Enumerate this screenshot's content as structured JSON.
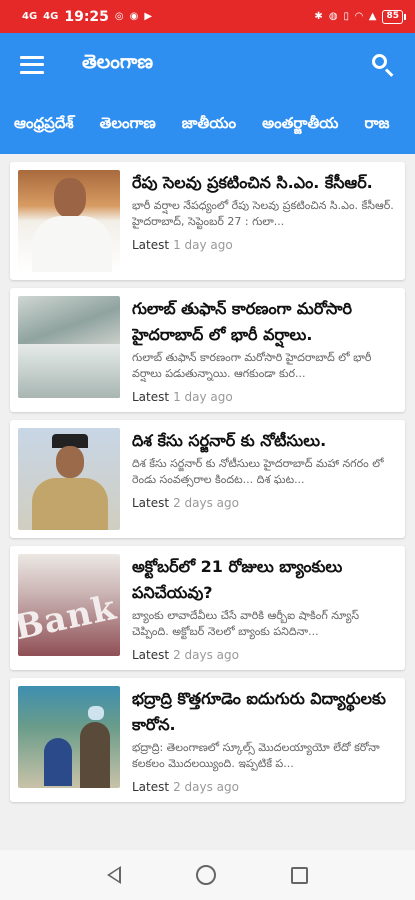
{
  "status_bar": {
    "signal_left": "4G",
    "signal_right": "4G",
    "time": "19:25",
    "battery": "85"
  },
  "app_bar": {
    "title": "తెలంగాణ",
    "menu_icon": "menu-icon",
    "search_icon": "search-icon"
  },
  "tabs": [
    "ఆంధ్రప్రదేశ్",
    "తెలంగాణ",
    "జాతీయం",
    "అంతర్జాతీయ",
    "రాజ"
  ],
  "articles": [
    {
      "title": "రేపు సెలవు ప్రకటించిన సి.ఎం. కేసీఆర్.",
      "snippet": "భారీ వర్షాల నేపధ్యంలో రేపు సెలవు ప్రకటించిన సి.ఎం. కేసీఆర్. హైదరాబాద్, సెప్టెంబర్ 27 : గులా...",
      "tag": "Latest",
      "time": "1 day ago"
    },
    {
      "title": "గులాబ్ తుఫాన్ కారణంగా మరోసారి హైదరాబాద్ లో భారీ వర్షాలు.",
      "snippet": "గులాబ్ తుఫాన్ కారణంగా మరోసారి హైదరాబాద్ లో భారీ వర్షాలు పడుతున్నాయి. ఆగకుండా కుర...",
      "tag": "Latest",
      "time": "1 day ago"
    },
    {
      "title": "దిశ కేసు సర్జనార్ కు నోటీసులు.",
      "snippet": "దిశ కేసు సర్జనార్ కు నోటీసులు హైదరాబాద్ మహా నగరం లో రెండు సంవత్సరాల కిందట... దిశ ఘట...",
      "tag": "Latest",
      "time": "2 days ago"
    },
    {
      "title": "అక్టోబర్‌లో 21 రోజులు బ్యాంకులు పనిచేయవు?",
      "snippet": "బ్యాంకు లావాదేవీలు చేసే వారికి ఆర్బీఐ షాకింగ్ న్యూస్ చెప్పింది. అక్టోబర్ నెలలో బ్యాంకు పనిదినా...",
      "tag": "Latest",
      "time": "2 days ago"
    },
    {
      "title": "భద్రాద్రి కొత్తగూడెం ఐదుగురు విద్యార్థులకు కారోన.",
      "snippet": "భద్రాద్రి: తెలంగాణలో స్కూల్స్ మొదలయ్యాయో లేదో కరోనా కలకలం మొదలయ్యింది. ఇప్పటికే ప...",
      "tag": "Latest",
      "time": "2 days ago"
    }
  ],
  "thumb_words": {
    "bank": "Bank"
  }
}
